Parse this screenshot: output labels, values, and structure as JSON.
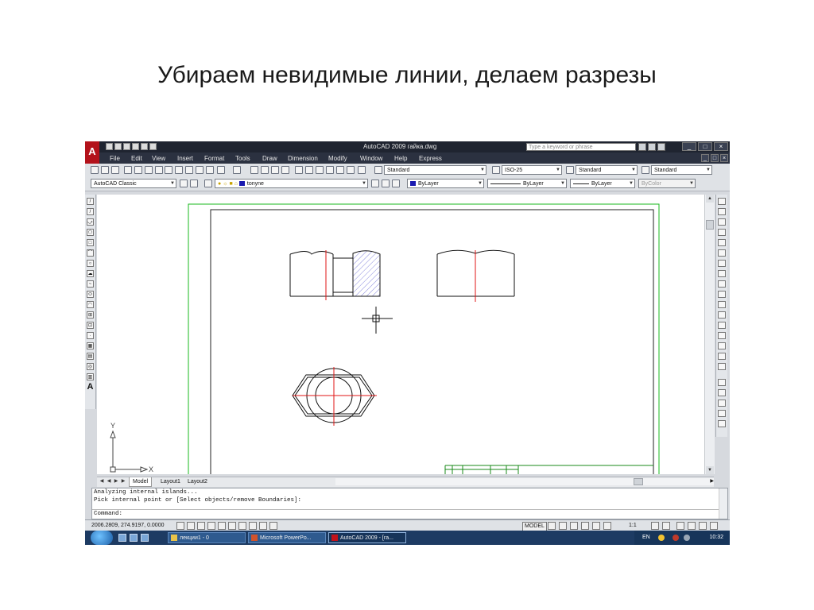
{
  "slide": {
    "title": "Убираем  невидимые линии, делаем разрезы"
  },
  "app": {
    "title": "AutoCAD 2009 гайка.dwg",
    "search_placeholder": "Type a keyword or phrase",
    "logo": "A",
    "window_controls": [
      "_",
      "□",
      "×"
    ]
  },
  "menu": [
    "File",
    "Edit",
    "View",
    "Insert",
    "Format",
    "Tools",
    "Draw",
    "Dimension",
    "Modify",
    "Window",
    "Help",
    "Express"
  ],
  "toolbar1": {
    "text_style": "Standard",
    "dim_style": "ISO-25",
    "table_style": "Standard",
    "multileader_style": "Standard"
  },
  "toolbar2": {
    "workspace": "AutoCAD Classic",
    "layer": "tonyne",
    "color": "ByLayer",
    "linetype": "ByLayer",
    "lineweight": "ByLayer",
    "plot_style": "ByColor"
  },
  "tabs": [
    "Model",
    "Layout1",
    "Layout2"
  ],
  "ucs": {
    "x_label": "X",
    "y_label": "Y"
  },
  "command": {
    "line1": "Analyzing internal islands...",
    "line2": "Pick internal point or [Select objects/remove Boundaries]:",
    "prompt": "Command:"
  },
  "status": {
    "coordinates": "2006.2809, 274.9197, 0.0000",
    "model": "MODEL",
    "scale": "1:1"
  },
  "taskbar": {
    "items": [
      "лекции1 - 0",
      "Microsoft PowerPo...",
      "AutoCAD 2009 - [ra..."
    ],
    "language": "EN",
    "clock": "10:32"
  },
  "colors": {
    "drawing_line": "#111111",
    "center_line": "#e01515",
    "border_green": "#19b81e",
    "hatch": "#6b6bd6"
  }
}
